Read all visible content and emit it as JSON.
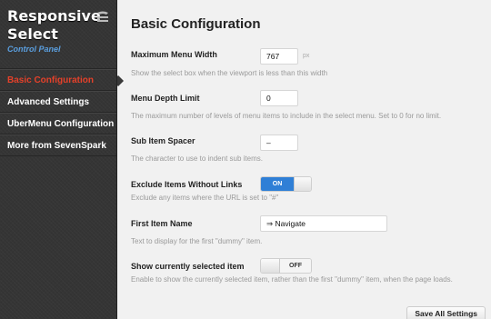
{
  "sidebar": {
    "title": "Responsive Select",
    "subtitle": "Control Panel",
    "logo_icon": "spark-logo-icon",
    "items": [
      {
        "label": "Basic Configuration",
        "active": true
      },
      {
        "label": "Advanced Settings",
        "active": false
      },
      {
        "label": "UberMenu Configuration",
        "active": false
      },
      {
        "label": "More from SevenSpark",
        "active": false
      }
    ]
  },
  "main": {
    "title": "Basic Configuration",
    "fields": {
      "max_width": {
        "label": "Maximum Menu Width",
        "value": "767",
        "suffix": "px",
        "description": "Show the select box when the viewport is less than this width"
      },
      "depth": {
        "label": "Menu Depth Limit",
        "value": "0",
        "description": "The maximum number of levels of menu items to include in the select menu. Set to 0 for no limit."
      },
      "spacer": {
        "label": "Sub Item Spacer",
        "value": "–",
        "description": "The character to use to indent sub items."
      },
      "exclude": {
        "label": "Exclude Items Without Links",
        "toggle_label": "ON",
        "state": "on",
        "description": "Exclude any items where the URL is set to \"#\""
      },
      "first_item": {
        "label": "First Item Name",
        "value": "⇒ Navigate",
        "description": "Text to display for the first \"dummy\" item."
      },
      "show_selected": {
        "label": "Show currently selected item",
        "toggle_label": "OFF",
        "state": "off",
        "description": "Enable to show the currently selected item, rather than the first \"dummy\" item, when the page loads."
      }
    },
    "save_label": "Save All Settings"
  },
  "colors": {
    "accent": "#e4412a",
    "toggle_on": "#2f7fd6",
    "sidebar_bg": "#353535",
    "link_blue": "#5a9ede"
  }
}
